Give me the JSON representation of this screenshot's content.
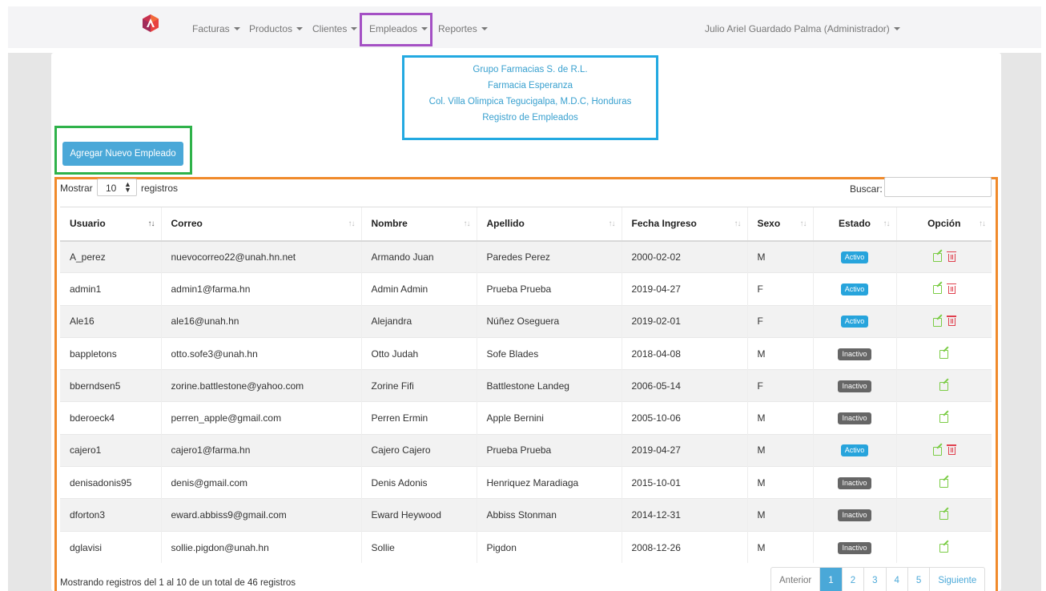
{
  "navbar": {
    "menus": [
      {
        "label": "Facturas"
      },
      {
        "label": "Productos"
      },
      {
        "label": "Clientes"
      },
      {
        "label": "Empleados"
      },
      {
        "label": "Reportes"
      }
    ],
    "user": "Julio Ariel Guardado Palma (Administrador)"
  },
  "company": {
    "line1": "Grupo Farmacias S. de R.L.",
    "line2": "Farmacia Esperanza",
    "line3": "Col. Villa Olimpica Tegucigalpa, M.D.C, Honduras",
    "line4": "Registro de Empleados"
  },
  "add_button": "Agregar Nuevo Empleado",
  "length_control": {
    "prefix": "Mostrar",
    "value": "10",
    "suffix": "registros"
  },
  "search": {
    "label": "Buscar:",
    "value": ""
  },
  "table": {
    "columns": [
      "Usuario",
      "Correo",
      "Nombre",
      "Apellido",
      "Fecha Ingreso",
      "Sexo",
      "Estado",
      "Opción"
    ],
    "rows": [
      {
        "usuario": "A_perez",
        "correo": "nuevocorreo22@unah.hn.net",
        "nombre": "Armando Juan",
        "apellido": "Paredes Perez",
        "fecha": "2000-02-02",
        "sexo": "M",
        "estado": "Activo",
        "can_delete": true
      },
      {
        "usuario": "admin1",
        "correo": "admin1@farma.hn",
        "nombre": "Admin Admin",
        "apellido": "Prueba Prueba",
        "fecha": "2019-04-27",
        "sexo": "F",
        "estado": "Activo",
        "can_delete": true
      },
      {
        "usuario": "Ale16",
        "correo": "ale16@unah.hn",
        "nombre": "Alejandra",
        "apellido": "Núñez Oseguera",
        "fecha": "2019-02-01",
        "sexo": "F",
        "estado": "Activo",
        "can_delete": true
      },
      {
        "usuario": "bappletons",
        "correo": "otto.sofe3@unah.hn",
        "nombre": "Otto Judah",
        "apellido": "Sofe Blades",
        "fecha": "2018-04-08",
        "sexo": "M",
        "estado": "Inactivo",
        "can_delete": false
      },
      {
        "usuario": "bberndsen5",
        "correo": "zorine.battlestone@yahoo.com",
        "nombre": "Zorine Fifi",
        "apellido": "Battlestone Landeg",
        "fecha": "2006-05-14",
        "sexo": "F",
        "estado": "Inactivo",
        "can_delete": false
      },
      {
        "usuario": "bderoeck4",
        "correo": "perren_apple@gmail.com",
        "nombre": "Perren Ermin",
        "apellido": "Apple Bernini",
        "fecha": "2005-10-06",
        "sexo": "M",
        "estado": "Inactivo",
        "can_delete": false
      },
      {
        "usuario": "cajero1",
        "correo": "cajero1@farma.hn",
        "nombre": "Cajero Cajero",
        "apellido": "Prueba Prueba",
        "fecha": "2019-04-27",
        "sexo": "M",
        "estado": "Activo",
        "can_delete": true
      },
      {
        "usuario": "denisadonis95",
        "correo": "denis@gmail.com",
        "nombre": "Denis Adonis",
        "apellido": "Henriquez Maradiaga",
        "fecha": "2015-10-01",
        "sexo": "M",
        "estado": "Inactivo",
        "can_delete": false
      },
      {
        "usuario": "dforton3",
        "correo": "eward.abbiss9@gmail.com",
        "nombre": "Eward Heywood",
        "apellido": "Abbiss Stonman",
        "fecha": "2014-12-31",
        "sexo": "M",
        "estado": "Inactivo",
        "can_delete": false
      },
      {
        "usuario": "dglavisi",
        "correo": "sollie.pigdon@unah.hn",
        "nombre": "Sollie",
        "apellido": "Pigdon",
        "fecha": "2008-12-26",
        "sexo": "M",
        "estado": "Inactivo",
        "can_delete": false
      }
    ]
  },
  "footer_info": "Mostrando registros del 1 al 10 de un total de 46 registros",
  "pagination": {
    "prev": "Anterior",
    "pages": [
      "1",
      "2",
      "3",
      "4",
      "5"
    ],
    "next": "Siguiente",
    "current": "1"
  },
  "colors": {
    "highlight_purple": "#a450c4",
    "highlight_blue": "#23a9e1",
    "highlight_green": "#2fb24a",
    "highlight_orange": "#f08a2b",
    "primary": "#4aa8d8"
  }
}
